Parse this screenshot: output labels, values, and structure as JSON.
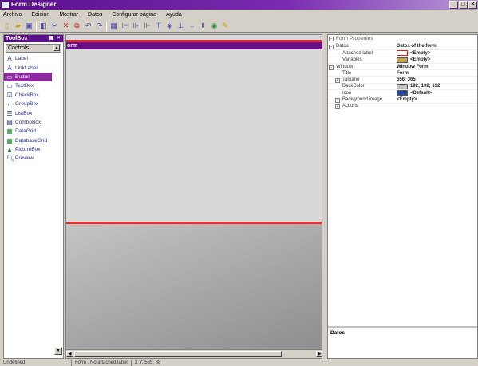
{
  "window": {
    "title": "Form Designer"
  },
  "menubar": {
    "items": [
      "Archivo",
      "Edición",
      "Mostrar",
      "Datos",
      "Configurar página",
      "Ayuda"
    ]
  },
  "toolbox": {
    "title": "ToolBox",
    "category": "Controls",
    "items": [
      {
        "label": "Label",
        "icon": "label-icon"
      },
      {
        "label": "LinkLabel",
        "icon": "linklabel-icon"
      },
      {
        "label": "Button",
        "icon": "button-icon",
        "selected": true
      },
      {
        "label": "TextBox",
        "icon": "textbox-icon"
      },
      {
        "label": "CheckBox",
        "icon": "checkbox-icon"
      },
      {
        "label": "GroupBox",
        "icon": "groupbox-icon"
      },
      {
        "label": "ListBox",
        "icon": "listbox-icon"
      },
      {
        "label": "ComboBox",
        "icon": "combobox-icon"
      },
      {
        "label": "DataGrid",
        "icon": "datagrid-icon"
      },
      {
        "label": "DatabaseGrid",
        "icon": "databasegrid-icon"
      },
      {
        "label": "PictureBox",
        "icon": "picturebox-icon"
      },
      {
        "label": "Preview",
        "icon": "preview-icon"
      }
    ]
  },
  "designer": {
    "form_title": "orm"
  },
  "properties": {
    "title": "Form Properties",
    "sections": {
      "datos": {
        "name": "Datos",
        "value": "Datos of the form"
      },
      "attached_label": {
        "name": "Attached label",
        "value": "<Empty>"
      },
      "variables": {
        "name": "Variables",
        "value": "<Empty>"
      },
      "window": {
        "name": "Window",
        "value": "Window Form"
      },
      "title": {
        "name": "Title",
        "value": "Form"
      },
      "tamano": {
        "name": "Tamaño",
        "value": "656; 365"
      },
      "backcolor": {
        "name": "BackColor",
        "value": "192; 192; 192",
        "color": "#c0c0c0"
      },
      "icon": {
        "name": "Icon",
        "value": "<Default>"
      },
      "background_image": {
        "name": "Background image",
        "value": "<Empty>"
      },
      "actions": {
        "name": "Actions",
        "value": ""
      }
    },
    "description": "Datos"
  },
  "statusbar": {
    "left": "Undefined",
    "middle": "Form . No attached label",
    "coords": "X Y: 565; 88"
  }
}
